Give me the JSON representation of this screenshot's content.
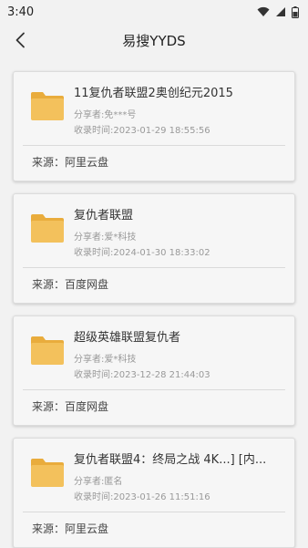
{
  "status": {
    "time": "3:40"
  },
  "header": {
    "title": "易搜YYDS"
  },
  "results": [
    {
      "title": "11复仇者联盟2奥创纪元2015",
      "sharer": "分享者:免***号",
      "time": "收录时间:2023-01-29 18:55:56",
      "source": "来源：阿里云盘"
    },
    {
      "title": "复仇者联盟",
      "sharer": "分享者:爱*科技",
      "time": "收录时间:2024-01-30 18:33:02",
      "source": "来源：百度网盘"
    },
    {
      "title": "超级英雄联盟复仇者",
      "sharer": "分享者:爱*科技",
      "time": "收录时间:2023-12-28 21:44:03",
      "source": "来源：百度网盘"
    },
    {
      "title": "复仇者联盟4：终局之战 4K...] [内...",
      "sharer": "分享者:匿名",
      "time": "收录时间:2023-01-26 11:51:16",
      "source": "来源：阿里云盘"
    }
  ],
  "colors": {
    "folder": "#f3c15c",
    "folder_tab": "#e9ac3c",
    "background": "#f2f2f2"
  },
  "icons": [
    "wifi-icon",
    "signal-icon",
    "battery-icon",
    "back-arrow-icon",
    "folder-icon"
  ]
}
